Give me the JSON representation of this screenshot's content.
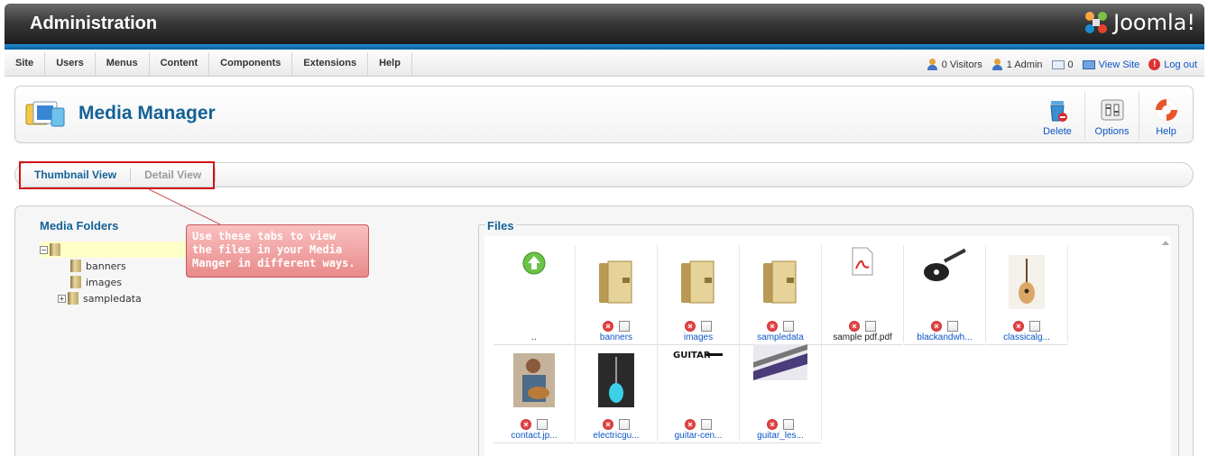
{
  "header": {
    "title": "Administration",
    "logo_text": "Joomla!"
  },
  "menu": {
    "items": [
      "Site",
      "Users",
      "Menus",
      "Content",
      "Components",
      "Extensions",
      "Help"
    ]
  },
  "status": {
    "visitors": "0 Visitors",
    "admins": "1 Admin",
    "messages": "0",
    "view_site": "View Site",
    "logout": "Log out"
  },
  "toolbar": {
    "page_title": "Media Manager",
    "buttons": [
      {
        "label": "Delete",
        "icon": "trash-icon"
      },
      {
        "label": "Options",
        "icon": "options-icon"
      },
      {
        "label": "Help",
        "icon": "lifebuoy-icon"
      }
    ]
  },
  "tabs": [
    {
      "label": "Thumbnail View",
      "active": true
    },
    {
      "label": "Detail View",
      "active": false
    }
  ],
  "callout": {
    "lines": [
      "Use these tabs to view",
      "the files in your Media",
      "Manger in different ways."
    ]
  },
  "folders": {
    "heading": "Media Folders",
    "items": [
      "banners",
      "images",
      "sampledata"
    ]
  },
  "files": {
    "heading": "Files",
    "items": [
      {
        "name": "..",
        "kind": "up"
      },
      {
        "name": "banners",
        "kind": "folder"
      },
      {
        "name": "images",
        "kind": "folder"
      },
      {
        "name": "sampledata",
        "kind": "folder"
      },
      {
        "name": "sample pdf.pdf",
        "kind": "pdf"
      },
      {
        "name": "blackandwh...",
        "kind": "image"
      },
      {
        "name": "classicalg...",
        "kind": "image"
      },
      {
        "name": "contact.jp...",
        "kind": "image"
      },
      {
        "name": "electricgu...",
        "kind": "image"
      },
      {
        "name": "guitar-cen...",
        "kind": "image"
      },
      {
        "name": "guitar_les...",
        "kind": "image"
      }
    ]
  },
  "colors": {
    "header_dark": "#151515",
    "header_blue": "#1f8fd6",
    "title_blue": "#146295",
    "link_blue": "#0b55c4",
    "highlight_red": "#d01414",
    "callout_pink": "#e98a8a"
  }
}
